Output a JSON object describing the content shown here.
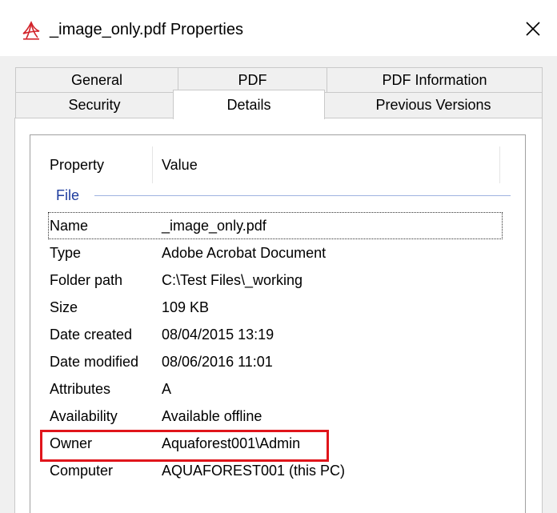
{
  "window": {
    "title": "_image_only.pdf Properties",
    "icon": "pdf-file-icon",
    "close_icon": "close-icon"
  },
  "tabs": {
    "top_row": [
      {
        "label": "General",
        "active": false
      },
      {
        "label": "PDF",
        "active": false
      },
      {
        "label": "PDF Information",
        "active": false
      }
    ],
    "bottom_row": [
      {
        "label": "Security",
        "active": false
      },
      {
        "label": "Details",
        "active": true
      },
      {
        "label": "Previous Versions",
        "active": false
      }
    ]
  },
  "details": {
    "headers": {
      "property": "Property",
      "value": "Value"
    },
    "group": "File",
    "rows": [
      {
        "property": "Name",
        "value": "_image_only.pdf"
      },
      {
        "property": "Type",
        "value": "Adobe Acrobat Document"
      },
      {
        "property": "Folder path",
        "value": "C:\\Test Files\\_working"
      },
      {
        "property": "Size",
        "value": "109 KB"
      },
      {
        "property": "Date created",
        "value": "08/04/2015 13:19"
      },
      {
        "property": "Date modified",
        "value": "08/06/2016 11:01"
      },
      {
        "property": "Attributes",
        "value": "A"
      },
      {
        "property": "Availability",
        "value": "Available offline"
      },
      {
        "property": "Owner",
        "value": "Aquaforest001\\Admin"
      },
      {
        "property": "Computer",
        "value": "AQUAFOREST001 (this PC)"
      }
    ]
  },
  "colors": {
    "group_label": "#1e3c9e",
    "highlight_box": "#e0151b",
    "pdf_icon": "#d2232a"
  }
}
